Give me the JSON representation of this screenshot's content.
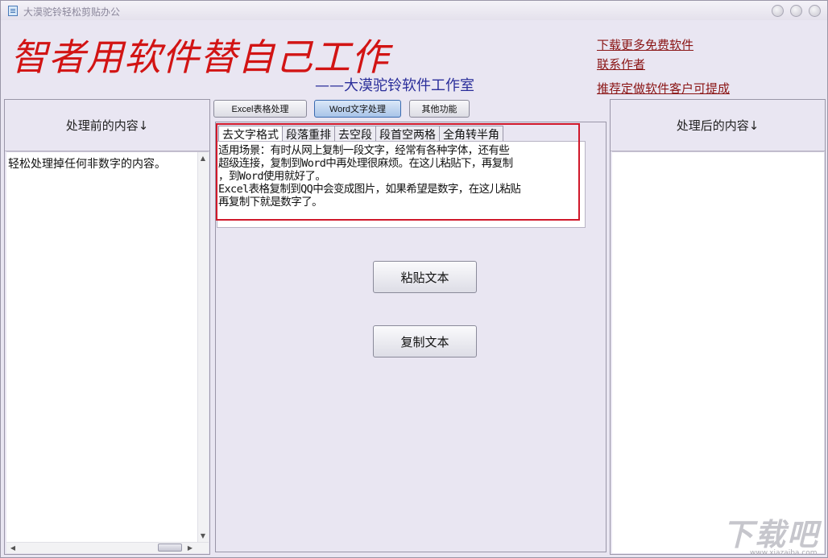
{
  "window": {
    "title": "大漠驼铃轻松剪贴办公"
  },
  "header": {
    "slogan": "智者用软件替自己工作",
    "studio": "——大漠驼铃软件工作室",
    "links": [
      "下载更多免费软件",
      "联系作者",
      "推荐定做软件客户可提成"
    ]
  },
  "left_panel": {
    "heading": "处理前的内容↓",
    "content": "轻松处理掉任何非数字的内容。"
  },
  "right_panel": {
    "heading": "处理后的内容↓",
    "content": ""
  },
  "toolbar": {
    "buttons": [
      "Excel表格处理",
      "Word文字处理",
      "其他功能"
    ],
    "active": "Word文字处理"
  },
  "tabs": [
    "去文字格式",
    "段落重排",
    "去空段",
    "段首空两格",
    "全角转半角"
  ],
  "description": {
    "lines": [
      "适用场景：有时从网上复制一段文字，经常有各种字体，还有些",
      "超级连接，复制到Word中再处理很麻烦。在这儿粘贴下，再复制",
      "，到Word使用就好了。",
      "Excel表格复制到QQ中会变成图片，如果希望是数字，在这儿粘贴",
      "再复制下就是数字了。"
    ]
  },
  "actions": {
    "paste": "粘贴文本",
    "copy": "复制文本"
  },
  "watermark": {
    "text": "下载吧",
    "url": "www.xiazaiba.com"
  },
  "colors": {
    "slogan": "#d21414",
    "studio": "#2a2e9a",
    "link": "#8a1414",
    "highlight_box": "#d0182a"
  }
}
